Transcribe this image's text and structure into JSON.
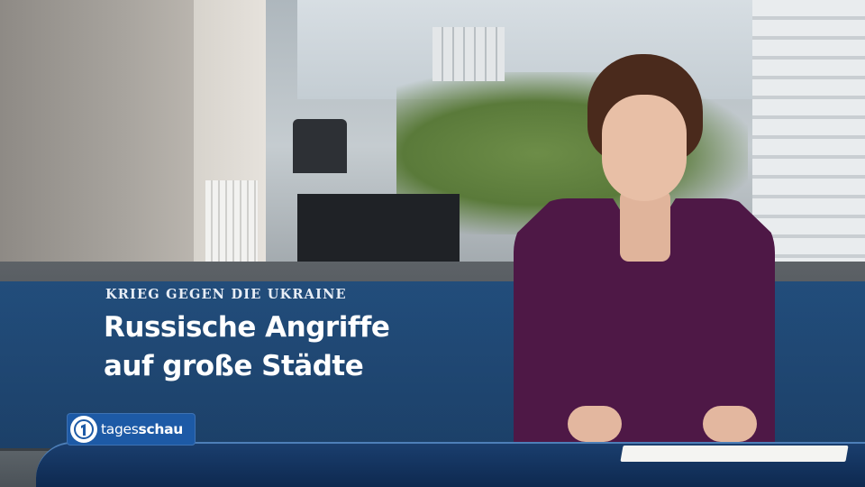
{
  "lower_third": {
    "kicker": "KRIEG GEGEN DIE UKRAINE",
    "headline_line1": "Russische Angriffe",
    "headline_line2": "auf große Städte"
  },
  "logo": {
    "icon": "ard-one-icon",
    "text_regular": "tages",
    "text_bold": "schau"
  },
  "colors": {
    "band": "#1a4f8c",
    "logo_bg": "#1d5aa6",
    "presenter_dress": "#4e1846"
  }
}
